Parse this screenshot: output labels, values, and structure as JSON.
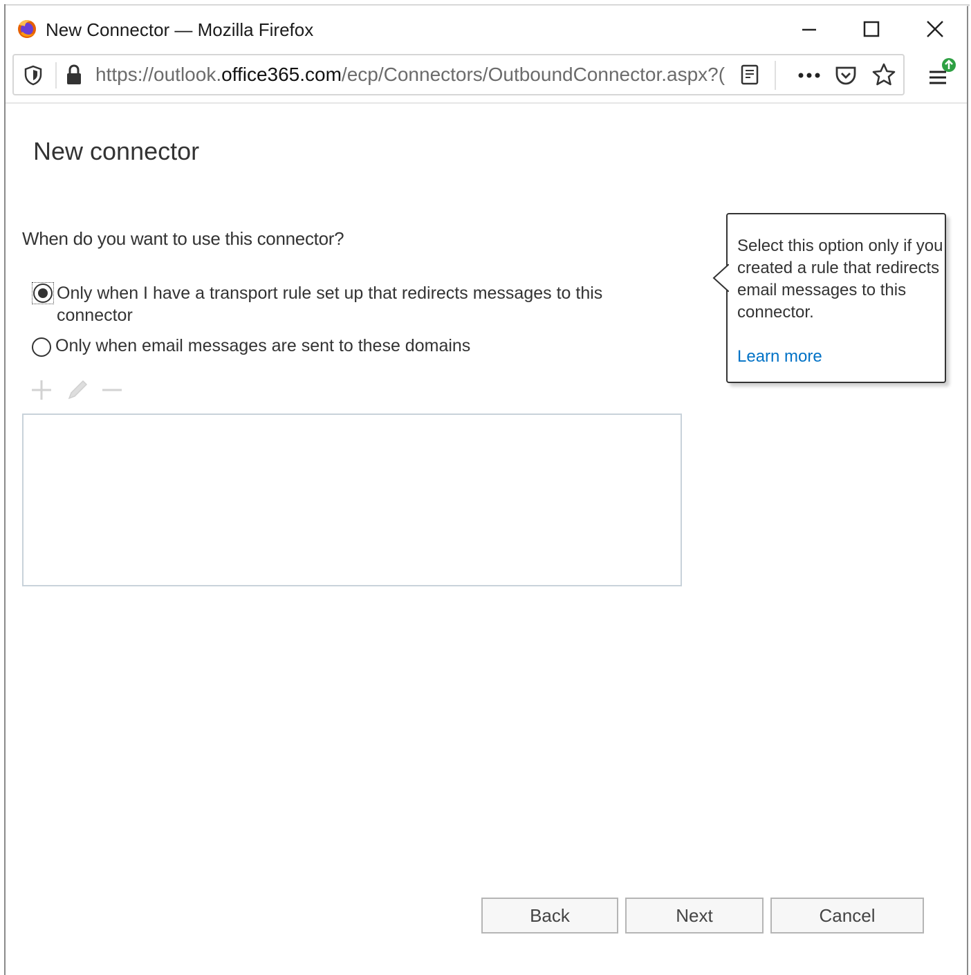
{
  "window": {
    "title": "New Connector — Mozilla Firefox"
  },
  "browser": {
    "url_prefix": "https://outlook.",
    "url_domain": "office365.com",
    "url_suffix": "/ecp/Connectors/OutboundConnector.aspx?("
  },
  "page": {
    "title": "New connector",
    "question": "When do you want to use this connector?",
    "options": [
      {
        "label": "Only when I have a transport rule set up that redirects messages to this connector",
        "selected": true
      },
      {
        "label": "Only when email messages are sent to these domains",
        "selected": false
      }
    ],
    "domains": []
  },
  "callout": {
    "text": "Select this option only if you created a rule that redirects email messages to this connector.",
    "link": "Learn more"
  },
  "buttons": {
    "back": "Back",
    "next": "Next",
    "cancel": "Cancel"
  },
  "colors": {
    "link": "#0072c6",
    "text": "#333333",
    "firefox_update_badge": "#2ea043"
  },
  "icons": [
    "firefox-logo-icon",
    "minimize-icon",
    "maximize-icon",
    "close-icon",
    "shield-icon",
    "lock-icon",
    "reader-view-icon",
    "more-icon",
    "pocket-icon",
    "bookmark-star-icon",
    "menu-icon",
    "add-icon",
    "edit-icon",
    "remove-icon"
  ]
}
